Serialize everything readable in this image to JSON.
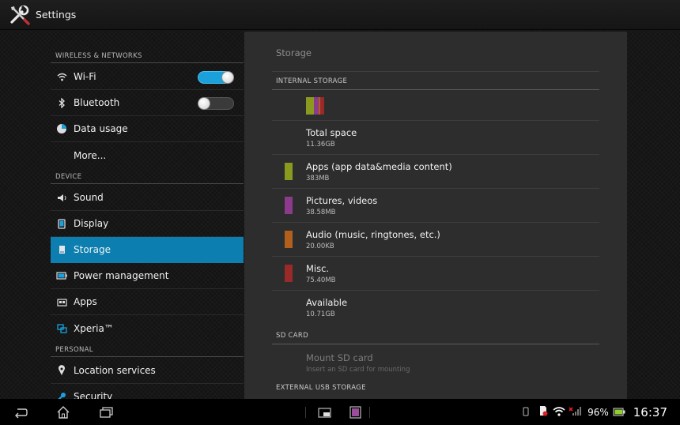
{
  "app": {
    "title": "Settings"
  },
  "sidebar": {
    "sections": [
      {
        "header": "WIRELESS & NETWORKS"
      },
      {
        "header": "DEVICE"
      },
      {
        "header": "PERSONAL"
      }
    ],
    "items": [
      {
        "label": "Wi-Fi",
        "icon": "wifi-icon",
        "toggle": "on"
      },
      {
        "label": "Bluetooth",
        "icon": "bluetooth-icon",
        "toggle": "off"
      },
      {
        "label": "Data usage",
        "icon": "data-usage-icon"
      },
      {
        "label": "More..."
      },
      {
        "label": "Sound",
        "icon": "speaker-icon"
      },
      {
        "label": "Display",
        "icon": "display-icon"
      },
      {
        "label": "Storage",
        "icon": "storage-icon",
        "selected": true
      },
      {
        "label": "Power management",
        "icon": "battery-icon"
      },
      {
        "label": "Apps",
        "icon": "apps-icon"
      },
      {
        "label": "Xperia™",
        "icon": "xperia-icon"
      },
      {
        "label": "Location services",
        "icon": "location-pin-icon"
      },
      {
        "label": "Security",
        "icon": "security-icon"
      }
    ]
  },
  "storage": {
    "title": "Storage",
    "internal_header": "INTERNAL STORAGE",
    "usage_bar": [
      {
        "name": "apps",
        "color": "#8a9a1e"
      },
      {
        "name": "pictures",
        "color": "#8c3a8c"
      },
      {
        "name": "audio",
        "color": "#b0601c"
      },
      {
        "name": "misc",
        "color": "#9a2a2a"
      }
    ],
    "rows": [
      {
        "title": "Total space",
        "value": "11.36GB"
      },
      {
        "title": "Apps (app data&media content)",
        "value": "383MB",
        "color": "#8a9a1e"
      },
      {
        "title": "Pictures, videos",
        "value": "38.58MB",
        "color": "#8c3a8c"
      },
      {
        "title": "Audio (music, ringtones, etc.)",
        "value": "20.00KB",
        "color": "#b0601c"
      },
      {
        "title": "Misc.",
        "value": "75.40MB",
        "color": "#9a2a2a"
      },
      {
        "title": "Available",
        "value": "10.71GB"
      }
    ],
    "sd_header": "SD CARD",
    "sd_row": {
      "title": "Mount SD card",
      "value": "Insert an SD card for mounting"
    },
    "usb_header": "EXTERNAL USB STORAGE"
  },
  "statusbar": {
    "battery": "96%",
    "time": "16:37",
    "colors": {
      "accent": "#0c7fb0",
      "battery": "#8fd12b",
      "alert": "#e02020"
    }
  }
}
